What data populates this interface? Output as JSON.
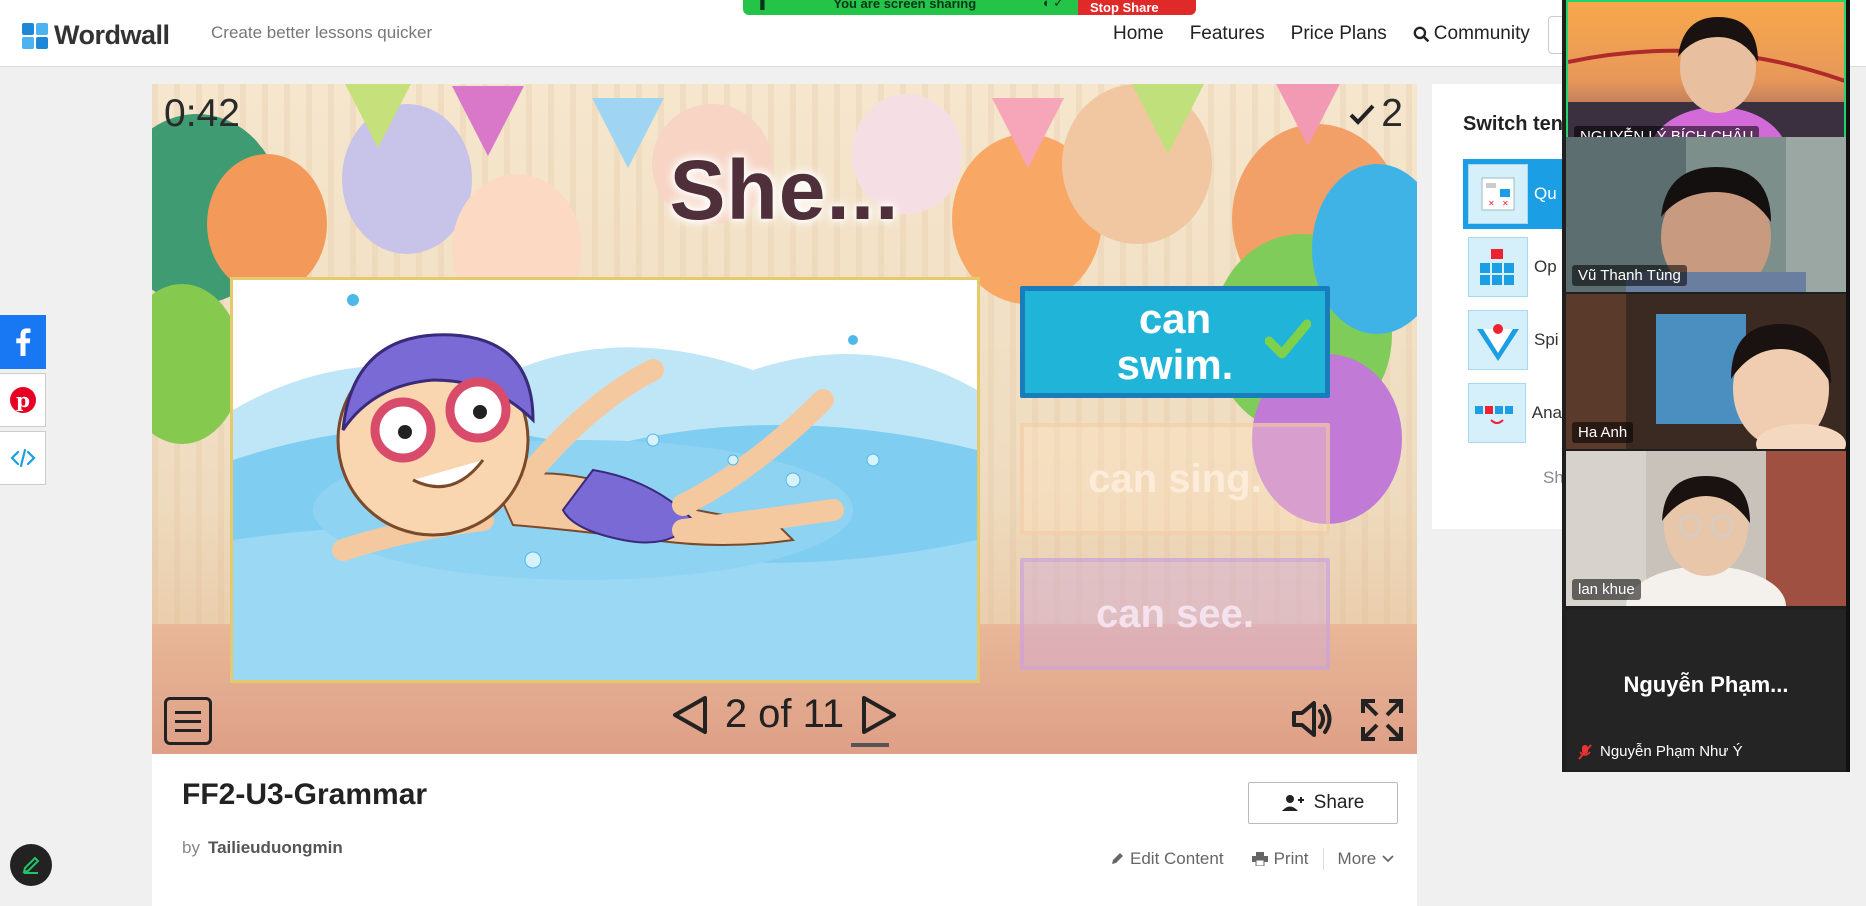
{
  "header": {
    "logo_text": "Wordwall",
    "tagline": "Create better lessons quicker",
    "nav": [
      "Home",
      "Features",
      "Price Plans",
      "Community"
    ]
  },
  "screen_share": {
    "status": "You are screen sharing",
    "stop_label": "Stop Share"
  },
  "game": {
    "timer": "0:42",
    "score": "2",
    "question": "She...",
    "answers": [
      "can swim.",
      "can sing.",
      "can see."
    ],
    "correct_answer_index": 0,
    "pager": "2 of 11"
  },
  "activity": {
    "title": "FF2-U3-Grammar",
    "by_label": "by",
    "author": "Tailieuduongmin",
    "share_label": "Share",
    "edit_label": "Edit Content",
    "print_label": "Print",
    "more_label": "More"
  },
  "switch_template": {
    "title": "Switch ten",
    "items": [
      "Qu",
      "Op",
      "Spi",
      "Ana"
    ],
    "show_more": "Sh"
  },
  "participants": [
    "NGUYỄN LÝ BÍCH CHÂU",
    "Vũ Thanh Tùng",
    "Ha Anh",
    "lan khue",
    "Nguyễn Phạm Như Ý"
  ],
  "participant_big_name": "Nguyễn Phạm...",
  "colors": {
    "accent": "#1b9ee3",
    "correct_answer": "#1fb4d8",
    "share_green": "#24c448",
    "stop_red": "#e02a2a",
    "facebook": "#1877f2",
    "pinterest": "#e60023"
  }
}
